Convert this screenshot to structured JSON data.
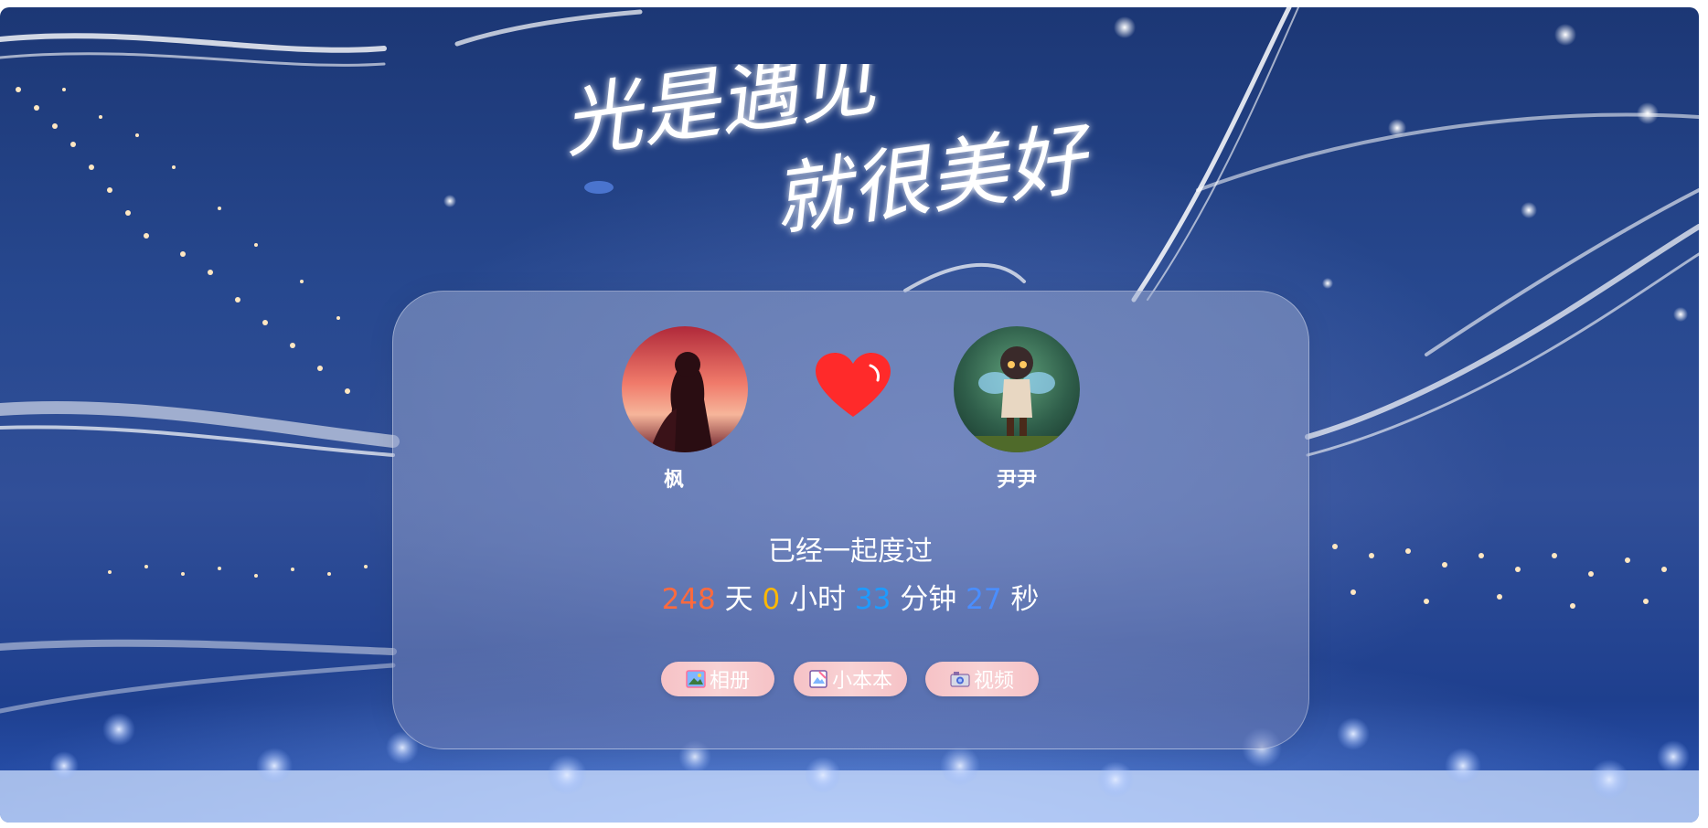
{
  "header": {
    "title_line1": "光是遇见",
    "title_line2": "就很美好"
  },
  "couple": {
    "left": {
      "name": "枫",
      "avatar": "avatar-left"
    },
    "right": {
      "name": "尹尹",
      "avatar": "avatar-right"
    },
    "heart_icon": "heart-icon"
  },
  "counter": {
    "label": "已经一起度过",
    "days": "248",
    "days_unit": "天",
    "hours": "0",
    "hours_unit": "小时",
    "minutes": "33",
    "minutes_unit": "分钟",
    "seconds": "27",
    "seconds_unit": "秒"
  },
  "buttons": {
    "album": {
      "label": "相册",
      "icon": "photo-icon"
    },
    "notebook": {
      "label": "小本本",
      "icon": "notebook-icon"
    },
    "video": {
      "label": "视频",
      "icon": "camera-icon"
    }
  },
  "colors": {
    "days": "#ff6a3d",
    "hours": "#ffb800",
    "minutes": "#1e9bff",
    "seconds": "#4a8eff",
    "heart": "#ff2a2a",
    "button": "#f6c2c6"
  }
}
